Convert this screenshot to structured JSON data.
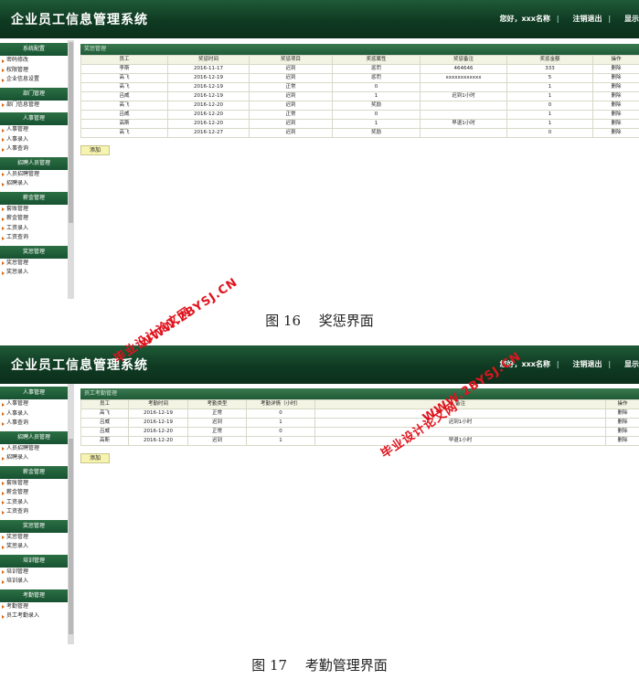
{
  "app_title": "企业员工信息管理系统",
  "user_bar": {
    "greeting": "您好，xxx名称",
    "logout": "注销退出",
    "display": "显示"
  },
  "reward_screen": {
    "menu": [
      {
        "title": "系统配置",
        "items": [
          "密码修改",
          "权限管理",
          "企业信息设置"
        ]
      },
      {
        "title": "部门管理",
        "items": [
          "部门信息管理"
        ]
      },
      {
        "title": "人事管理",
        "items": [
          "人事管理",
          "人事录入",
          "人事查询"
        ]
      },
      {
        "title": "招聘人员管理",
        "items": [
          "人员招聘管理",
          "招聘录入"
        ]
      },
      {
        "title": "薪金管理",
        "items": [
          "套账管理",
          "薪金管理",
          "工资录入",
          "工资查询"
        ]
      },
      {
        "title": "奖惩管理",
        "items": [
          "奖惩管理",
          "奖惩录入"
        ]
      }
    ],
    "panel_title": "奖惩管理",
    "columns": [
      "员工",
      "奖惩时间",
      "奖惩项目",
      "奖惩属性",
      "奖惩备注",
      "奖惩金额",
      "操作"
    ],
    "rows": [
      [
        "李斯",
        "2016-11-17",
        "迟到",
        "惩罚",
        "464646",
        "333",
        "删除"
      ],
      [
        "高飞",
        "2016-12-19",
        "迟到",
        "惩罚",
        "xxxxxxxxxxxx",
        "5",
        "删除"
      ],
      [
        "高飞",
        "2016-12-19",
        "正常",
        "0",
        "",
        "1",
        "删除"
      ],
      [
        "吕威",
        "2016-12-19",
        "迟到",
        "1",
        "迟到1小时",
        "1",
        "删除"
      ],
      [
        "高飞",
        "2016-12-20",
        "迟到",
        "奖励",
        "",
        "0",
        "删除"
      ],
      [
        "吕威",
        "2016-12-20",
        "正常",
        "0",
        "",
        "1",
        "删除"
      ],
      [
        "高斯",
        "2016-12-20",
        "迟到",
        "1",
        "早退1小时",
        "1",
        "删除"
      ],
      [
        "高飞",
        "2016-12-27",
        "迟到",
        "奖励",
        "",
        "0",
        "删除"
      ]
    ],
    "add_label": "添加",
    "caption": "图 16　 奖惩界面"
  },
  "attendance_screen": {
    "menu": [
      {
        "title": "人事管理",
        "items": [
          "人事管理",
          "人事录入",
          "人事查询"
        ]
      },
      {
        "title": "招聘人员管理",
        "items": [
          "人员招聘管理",
          "招聘录入"
        ]
      },
      {
        "title": "薪金管理",
        "items": [
          "套账管理",
          "薪金管理",
          "工资录入",
          "工资查询"
        ]
      },
      {
        "title": "奖惩管理",
        "items": [
          "奖惩管理",
          "奖惩录入"
        ]
      },
      {
        "title": "培训管理",
        "items": [
          "培训管理",
          "培训录入"
        ]
      },
      {
        "title": "考勤管理",
        "items": [
          "考勤管理",
          "员工考勤录入"
        ]
      }
    ],
    "panel_title": "员工考勤管理",
    "columns": [
      "员工",
      "考勤时间",
      "考勤类型",
      "考勤详情（小时）",
      "备注",
      "操作"
    ],
    "rows": [
      [
        "高飞",
        "2016-12-19",
        "正常",
        "0",
        "",
        "删除"
      ],
      [
        "吕威",
        "2016-12-19",
        "迟到",
        "1",
        "迟到1小时",
        "删除"
      ],
      [
        "吕威",
        "2016-12-20",
        "正常",
        "0",
        "",
        "删除"
      ],
      [
        "高斯",
        "2016-12-20",
        "迟到",
        "1",
        "早退1小时",
        "删除"
      ]
    ],
    "add_label": "添加",
    "caption": "图 17　 考勤管理界面"
  },
  "watermarks": [
    "毕业设计论文网",
    "WWW.2BYSJ.CN"
  ]
}
